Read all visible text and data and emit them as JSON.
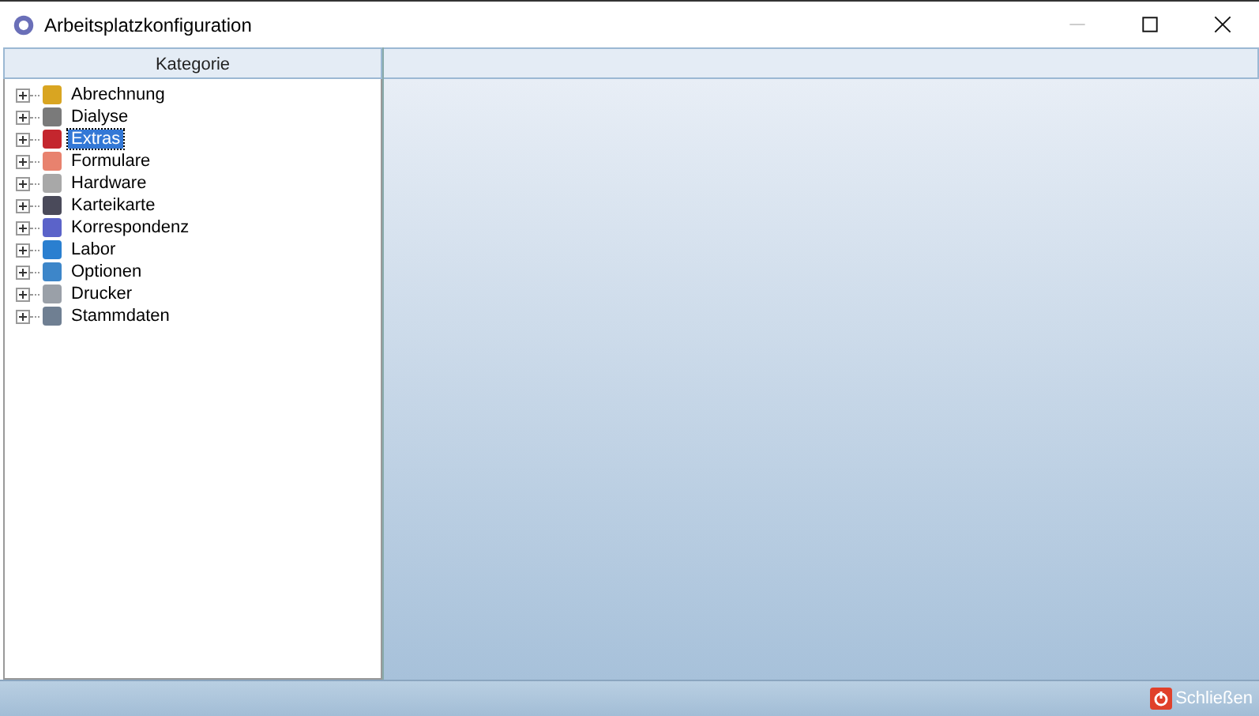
{
  "window": {
    "title": "Arbeitsplatzkonfiguration"
  },
  "tree": {
    "header": "Kategorie",
    "items": [
      {
        "label": "Abrechnung",
        "expanded": false,
        "selected": false,
        "color": "#d9a521"
      },
      {
        "label": "Dialyse",
        "expanded": false,
        "selected": false,
        "color": "#7a7a7a"
      },
      {
        "label": "Extras",
        "expanded": false,
        "selected": true,
        "color": "#c4262e"
      },
      {
        "label": "Formulare",
        "expanded": false,
        "selected": false,
        "color": "#e8826e"
      },
      {
        "label": "Hardware",
        "expanded": false,
        "selected": false,
        "color": "#a8a8a8"
      },
      {
        "label": "Karteikarte",
        "expanded": false,
        "selected": false,
        "color": "#4a4a5a"
      },
      {
        "label": "Korrespondenz",
        "expanded": false,
        "selected": false,
        "color": "#5b63c9"
      },
      {
        "label": "Labor",
        "expanded": false,
        "selected": false,
        "color": "#2a7fd0"
      },
      {
        "label": "Optionen",
        "expanded": false,
        "selected": false,
        "color": "#3d86c9"
      },
      {
        "label": "Drucker",
        "expanded": false,
        "selected": false,
        "color": "#9aa0a8"
      },
      {
        "label": "Stammdaten",
        "expanded": false,
        "selected": false,
        "color": "#6f7f92"
      }
    ]
  },
  "footer": {
    "close_button": "Schließen"
  }
}
